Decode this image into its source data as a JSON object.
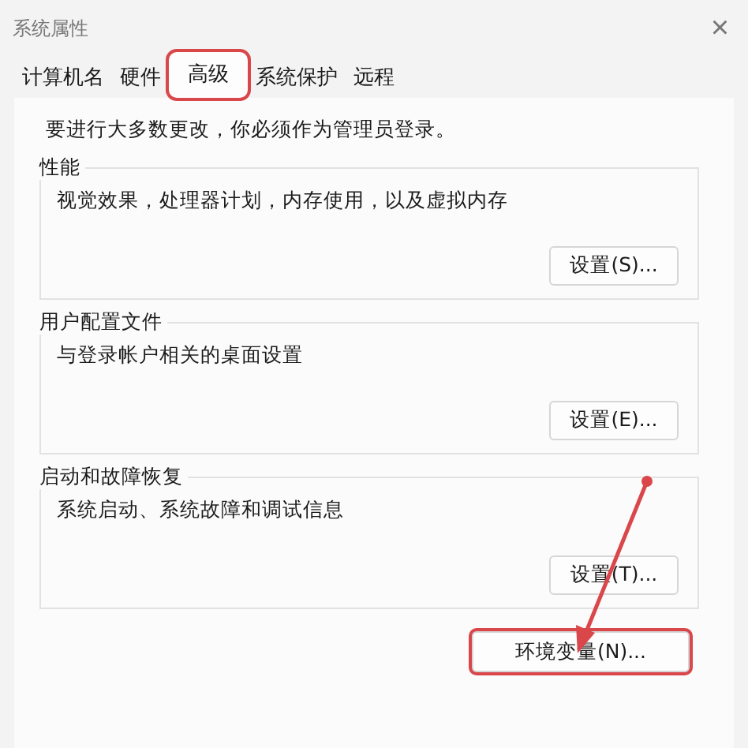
{
  "window": {
    "title": "系统属性",
    "close": "×"
  },
  "tabs": [
    {
      "label": "计算机名",
      "selected": false,
      "highlighted": false
    },
    {
      "label": "硬件",
      "selected": false,
      "highlighted": false
    },
    {
      "label": "高级",
      "selected": true,
      "highlighted": true
    },
    {
      "label": "系统保护",
      "selected": false,
      "highlighted": false
    },
    {
      "label": "远程",
      "selected": false,
      "highlighted": false
    }
  ],
  "notice": "要进行大多数更改，你必须作为管理员登录。",
  "groups": [
    {
      "title": "性能",
      "description": "视觉效果，处理器计划，内存使用，以及虚拟内存",
      "button": "设置(S)..."
    },
    {
      "title": "用户配置文件",
      "description": "与登录帐户相关的桌面设置",
      "button": "设置(E)..."
    },
    {
      "title": "启动和故障恢复",
      "description": "系统启动、系统故障和调试信息",
      "button": "设置(T)..."
    }
  ],
  "footer_button": {
    "label": "环境变量(N)...",
    "highlighted": true
  },
  "annotation_arrow": true
}
